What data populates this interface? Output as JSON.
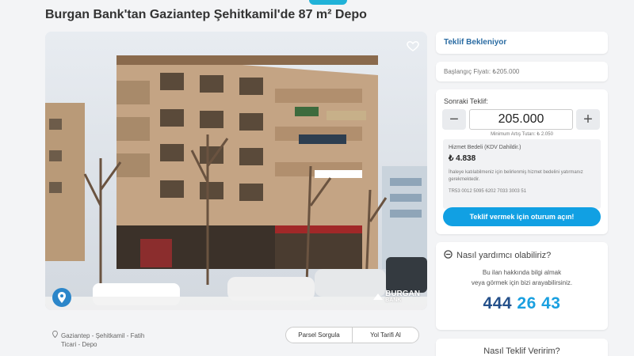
{
  "page": {
    "title": "Burgan Bank'tan Gaziantep Şehitkamil'de 87 m² Depo"
  },
  "listing": {
    "location_line1": "Gaziantep - Şehitkamil - Fatih",
    "location_line2": "Ticari - Depo",
    "parcel_button": "Parsel Sorgula",
    "directions_button": "Yol Tarifi Al",
    "watermark_line1": "BURGAN",
    "watermark_line2": "BANK"
  },
  "bid": {
    "status": "Teklif Bekleniyor",
    "starting_price": "Başlangıç Fiyatı: ₺205.000",
    "next_bid_label": "Sonraki Teklif:",
    "next_bid_value": "205.000",
    "min_increment": "Minimum Artış Tutarı: ₺ 2.050",
    "minus": "−",
    "plus": "+",
    "fee_title": "Hizmet Bedeli (KDV Dahildir.)",
    "fee_amount": "₺ 4.838",
    "fee_note": "İhaleye katılabilmeniz için belirlenmiş hizmet bedelini yatırmanız gerekmektedir.",
    "iban": "TR53 0012 5095 6202 7033 3003 51",
    "login_button": "Teklif vermek için oturum açın!"
  },
  "help": {
    "title": "Nasıl yardımcı olabiliriz?",
    "text_line1": "Bu ilan hakkında bilgi almak",
    "text_line2": "veya görmek için bizi arayabilirsiniz.",
    "phone_part1": "444",
    "phone_part2": "26 43"
  },
  "how_to": {
    "title": "Nasıl Teklif Veririm?"
  },
  "colors": {
    "accent": "#11a0e3",
    "phone_dark": "#24508a",
    "status_text": "#2b6ca3"
  },
  "icons": [
    "heart-icon",
    "map-pin-icon",
    "location-pin-icon",
    "question-circle-icon"
  ]
}
